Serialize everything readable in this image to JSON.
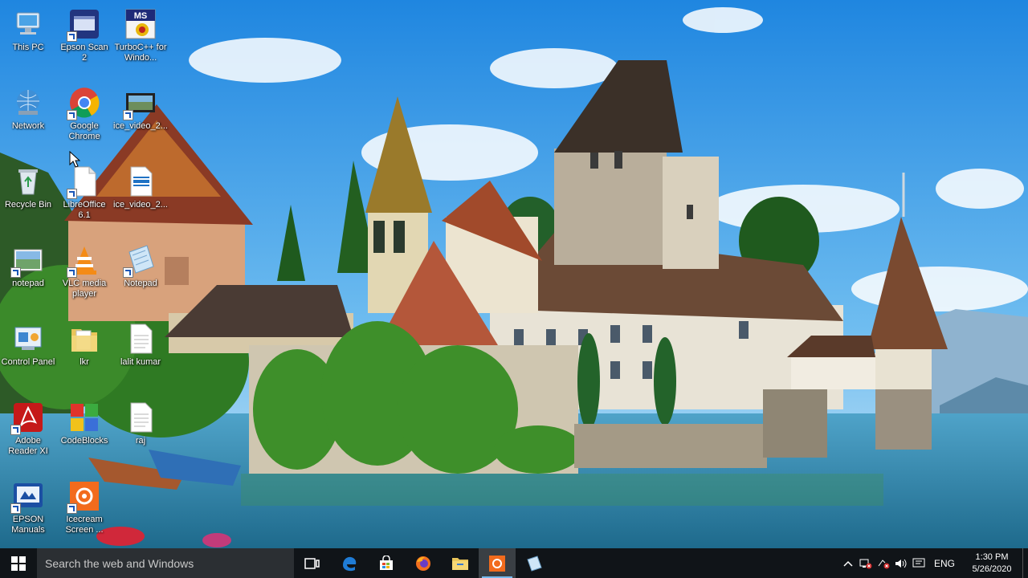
{
  "desktop_icons": [
    {
      "id": "this-pc",
      "label": "This PC",
      "icon": "computer-icon"
    },
    {
      "id": "epson-scan-2",
      "label": "Epson Scan 2",
      "icon": "scanner-icon"
    },
    {
      "id": "turboc",
      "label": "TurboC++ for Windo...",
      "icon": "turboc-icon",
      "badge": "MS"
    },
    {
      "id": "network",
      "label": "Network",
      "icon": "network-icon"
    },
    {
      "id": "google-chrome",
      "label": "Google Chrome",
      "icon": "chrome-icon"
    },
    {
      "id": "ice-video-1",
      "label": "ice_video_2...",
      "icon": "video-thumbnail-icon"
    },
    {
      "id": "recycle-bin",
      "label": "Recycle Bin",
      "icon": "recycle-bin-icon"
    },
    {
      "id": "libreoffice",
      "label": "LibreOffice 6.1",
      "icon": "document-icon"
    },
    {
      "id": "ice-video-2",
      "label": "ice_video_2...",
      "icon": "video-file-icon"
    },
    {
      "id": "notepad-image",
      "label": "notepad",
      "icon": "image-file-icon"
    },
    {
      "id": "vlc",
      "label": "VLC media player",
      "icon": "vlc-icon"
    },
    {
      "id": "notepad",
      "label": "Notepad",
      "icon": "notepad-icon"
    },
    {
      "id": "control-panel",
      "label": "Control Panel",
      "icon": "control-panel-icon"
    },
    {
      "id": "lkr",
      "label": "lkr",
      "icon": "folder-icon"
    },
    {
      "id": "lalit-kumar",
      "label": "lalit kumar",
      "icon": "text-file-icon"
    },
    {
      "id": "adobe-reader",
      "label": "Adobe Reader XI",
      "icon": "adobe-reader-icon"
    },
    {
      "id": "codeblocks",
      "label": "CodeBlocks",
      "icon": "codeblocks-icon"
    },
    {
      "id": "raj",
      "label": "raj",
      "icon": "text-file-icon"
    },
    {
      "id": "epson-manuals",
      "label": "EPSON Manuals",
      "icon": "epson-manuals-icon"
    },
    {
      "id": "icecream",
      "label": "Icecream Screen ...",
      "icon": "icecream-icon"
    }
  ],
  "taskbar": {
    "search_placeholder": "Search the web and Windows",
    "apps": [
      {
        "name": "task-view",
        "icon": "task-view-icon"
      },
      {
        "name": "edge",
        "icon": "edge-icon"
      },
      {
        "name": "store",
        "icon": "store-icon"
      },
      {
        "name": "firefox",
        "icon": "firefox-icon"
      },
      {
        "name": "file-explorer",
        "icon": "folder-icon"
      },
      {
        "name": "icecream-recorder",
        "icon": "icecream-icon",
        "active": true
      },
      {
        "name": "notepad",
        "icon": "notepad-icon"
      }
    ],
    "tray": {
      "language": "ENG",
      "time": "1:30 PM",
      "date": "5/26/2020"
    }
  },
  "colors": {
    "taskbar": "#101418",
    "accent": "#76b9ed",
    "sky": "#3a9be0",
    "water": "#2f7fa8"
  }
}
